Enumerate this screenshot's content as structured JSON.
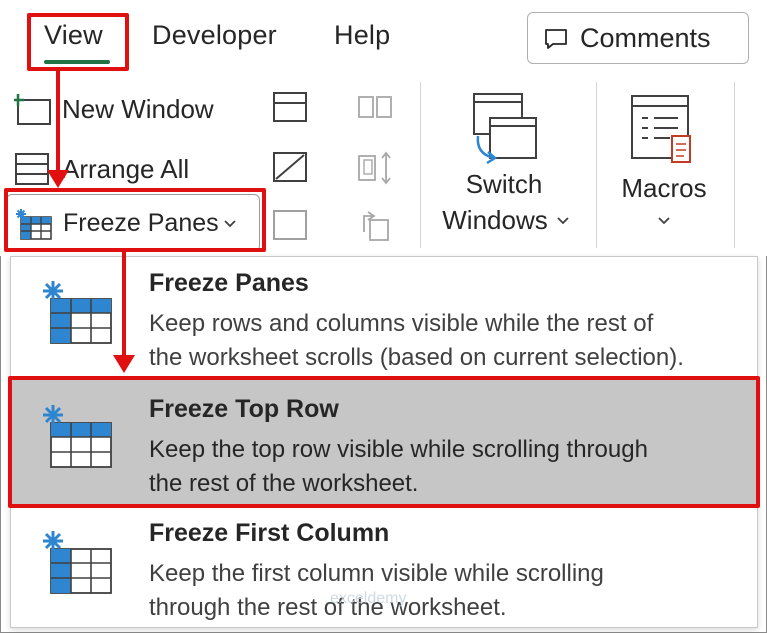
{
  "tabs": [
    {
      "label": "View"
    },
    {
      "label": "Developer"
    },
    {
      "label": "Help"
    }
  ],
  "comments_button": {
    "label": "Comments"
  },
  "ribbon": {
    "new_window": "New Window",
    "arrange_all": "Arrange All",
    "freeze_panes": "Freeze Panes",
    "switch_windows_line1": "Switch",
    "switch_windows_line2": "Windows",
    "macros": "Macros"
  },
  "menu": {
    "items": [
      {
        "title": "Freeze Panes",
        "desc_line1": "Keep rows and columns visible while the rest of",
        "desc_line2": "the worksheet scrolls (based on current selection).",
        "highlighted_row": "none"
      },
      {
        "title": "Freeze Top Row",
        "desc_line1": "Keep the top row visible while scrolling through",
        "desc_line2": "the rest of the worksheet.",
        "highlighted_row": "top"
      },
      {
        "title": "Freeze First Column",
        "desc_line1": "Keep the first column visible while scrolling",
        "desc_line2": "through the rest of the worksheet.",
        "highlighted_row": "left"
      }
    ],
    "selected_index": 1
  },
  "watermark": "exceldemy",
  "colors": {
    "annotation_red": "#e01010",
    "excel_green": "#217346",
    "icon_blue": "#2e86d1",
    "selected_bg": "#c6c6c6"
  }
}
